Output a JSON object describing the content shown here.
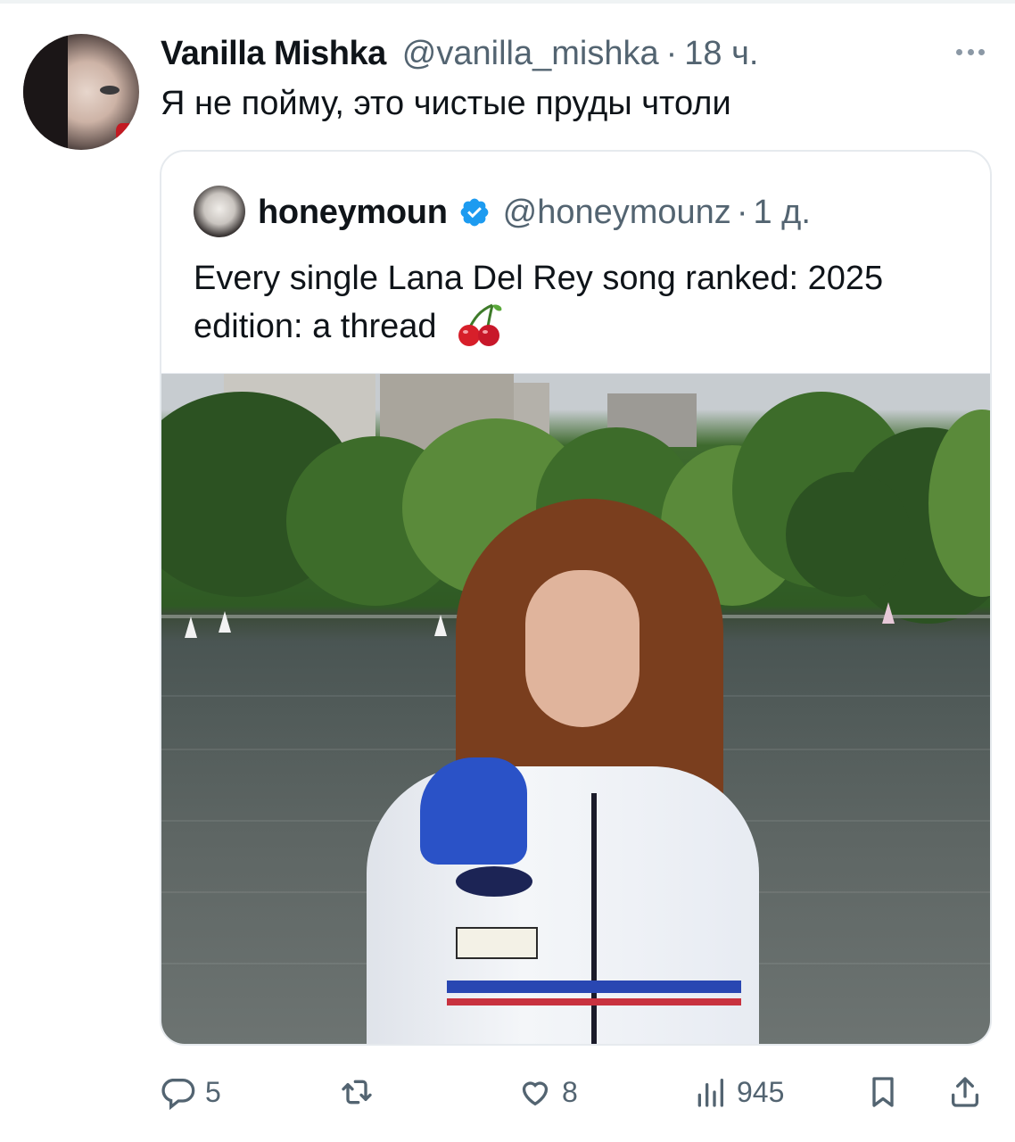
{
  "tweet": {
    "author": {
      "display_name": "Vanilla Mishka",
      "handle": "@vanilla_mishka",
      "separator": "·",
      "time": "18 ч."
    },
    "text": "Я не пойму, это чистые пруды чтоли",
    "more_icon": "more-horizontal-icon"
  },
  "quoted_tweet": {
    "author": {
      "display_name": "honeymoun",
      "verified": true,
      "handle": "@honeymounz",
      "separator": "·",
      "time": "1 д."
    },
    "text": "Every single Lana Del Rey song ranked: 2025 edition: a thread",
    "emoji": "🍒"
  },
  "actions": {
    "reply": {
      "icon": "reply-icon",
      "count": "5"
    },
    "retweet": {
      "icon": "retweet-icon",
      "count": ""
    },
    "like": {
      "icon": "heart-icon",
      "count": "8"
    },
    "views": {
      "icon": "analytics-icon",
      "count": "945"
    },
    "bookmark": {
      "icon": "bookmark-icon"
    },
    "share": {
      "icon": "share-icon"
    }
  },
  "colors": {
    "text_primary": "#0f1419",
    "text_secondary": "#536471",
    "verified_blue": "#1d9bf0",
    "border": "#e6eaee"
  }
}
